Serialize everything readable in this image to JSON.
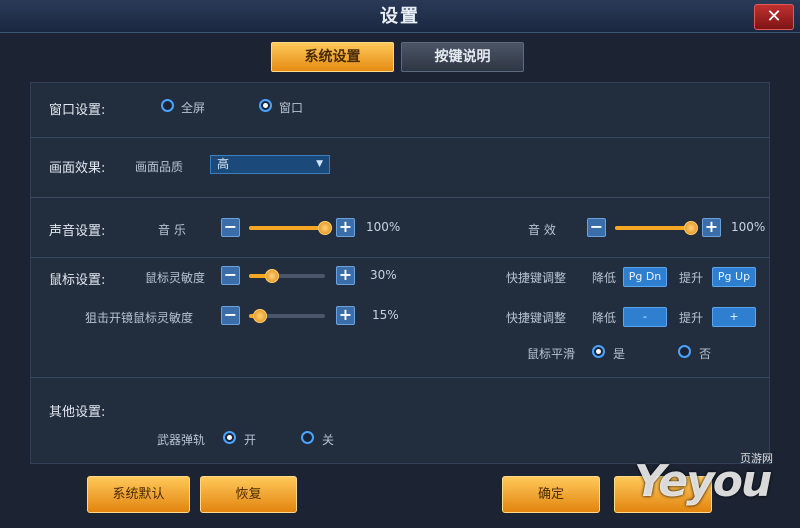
{
  "window": {
    "title": "设置",
    "close_glyph": "✕"
  },
  "tabs": [
    {
      "label": "系统设置",
      "active": true
    },
    {
      "label": "按键说明",
      "active": false
    }
  ],
  "window_mode": {
    "label": "窗口设置:",
    "options": [
      {
        "label": "全屏",
        "selected": false
      },
      {
        "label": "窗口",
        "selected": true
      }
    ]
  },
  "display": {
    "label": "画面效果:",
    "quality_label": "画面品质",
    "quality_value": "高"
  },
  "sound": {
    "label": "声音设置:",
    "music": {
      "label": "音    乐",
      "value": "100%",
      "level": 1.0
    },
    "effects": {
      "label": "音    效",
      "value": "100%",
      "level": 1.0
    }
  },
  "mouse": {
    "label": "鼠标设置:",
    "sensitivity": {
      "label": "鼠标灵敏度",
      "value": "30%",
      "level": 0.3
    },
    "scope_sensitivity": {
      "label": "狙击开镜鼠标灵敏度",
      "value": "15%",
      "level": 0.15
    },
    "hotkey1": {
      "label": "快捷键调整",
      "lower_label": "降低",
      "lower_key": "Pg Dn",
      "raise_label": "提升",
      "raise_key": "Pg Up"
    },
    "hotkey2": {
      "label": "快捷键调整",
      "lower_label": "降低",
      "lower_key": "-",
      "raise_label": "提升",
      "raise_key": "+"
    },
    "smoothing": {
      "label": "鼠标平滑",
      "options": [
        {
          "label": "是",
          "selected": true
        },
        {
          "label": "否",
          "selected": false
        }
      ]
    }
  },
  "other": {
    "label": "其他设置:",
    "weapon_trail": {
      "label": "武器弹轨",
      "options": [
        {
          "label": "开",
          "selected": true
        },
        {
          "label": "关",
          "selected": false
        }
      ]
    }
  },
  "buttons": {
    "default": "系统默认",
    "restore": "恢复",
    "confirm": "确定"
  },
  "stepper_minus": "−",
  "stepper_plus": "+",
  "watermark": {
    "logo": "Yeyou",
    "cn": "页游网"
  },
  "colors": {
    "accent": "#f5a623",
    "blue": "#2e7fcf"
  }
}
